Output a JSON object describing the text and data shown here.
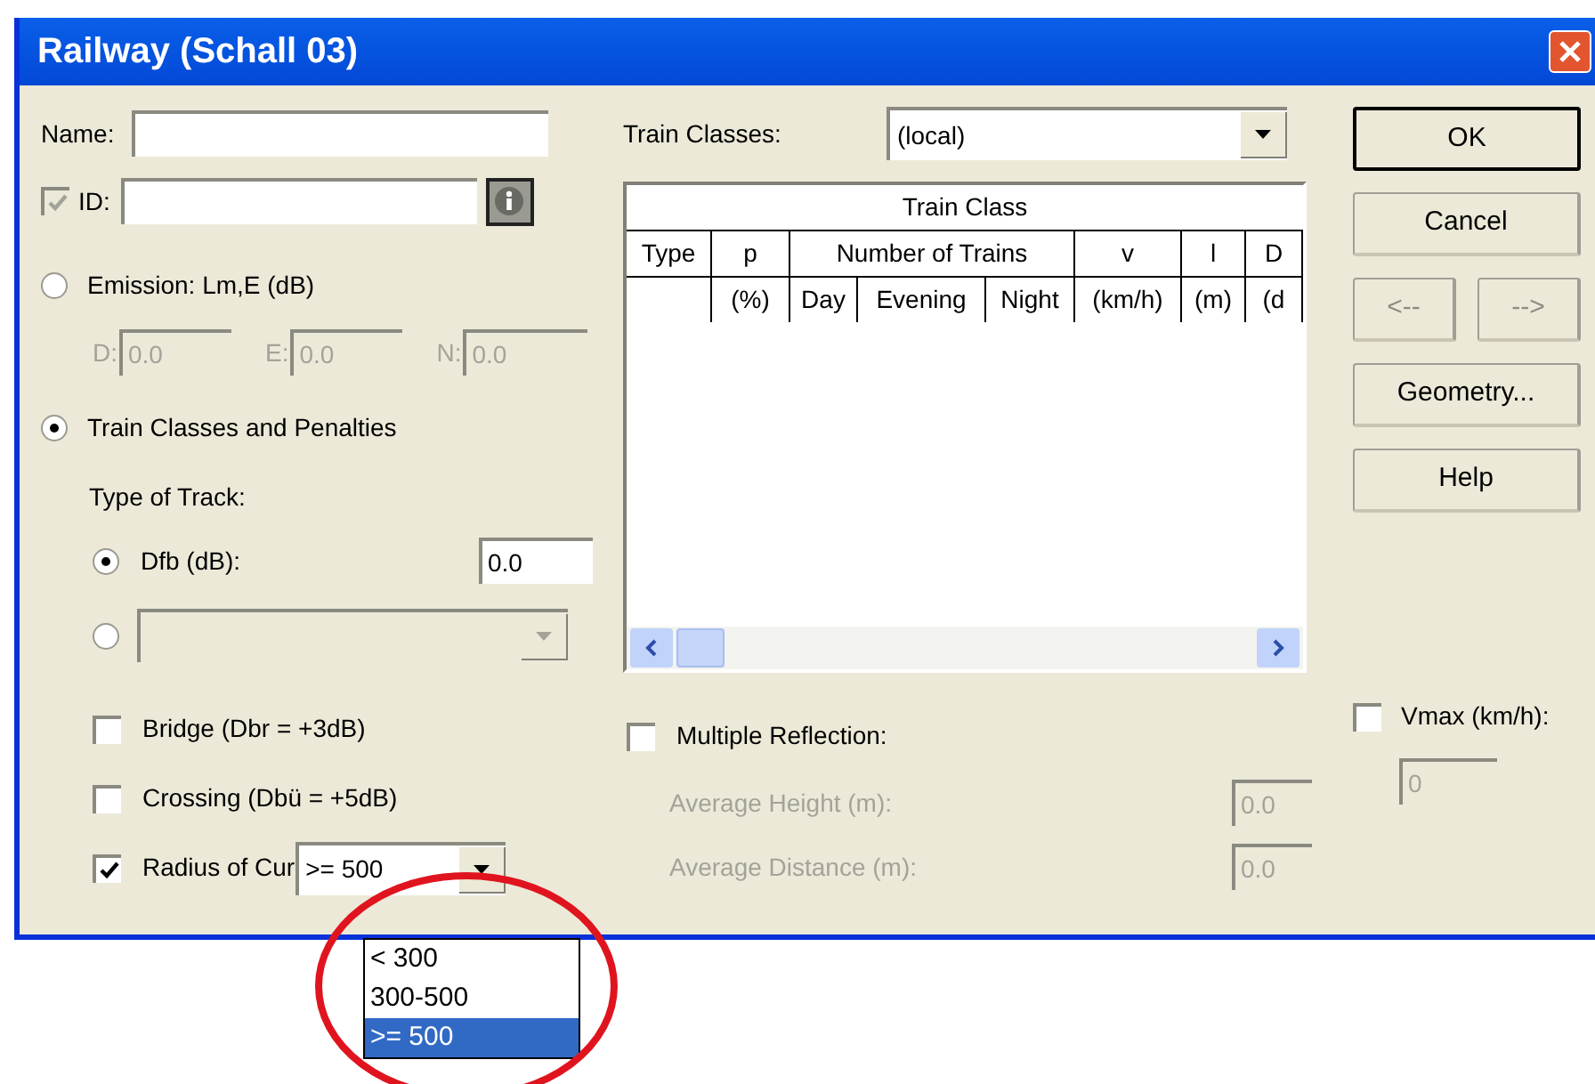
{
  "window": {
    "title": "Railway (Schall 03)"
  },
  "name_field": {
    "label": "Name:"
  },
  "id_field": {
    "label": "ID:",
    "checked": true,
    "disabled": true
  },
  "emission": {
    "label": "Emission: Lm,E (dB)",
    "selected": false,
    "fields": [
      {
        "label": "D:",
        "value": "0.0",
        "disabled": true
      },
      {
        "label": "E:",
        "value": "0.0",
        "disabled": true
      },
      {
        "label": "N:",
        "value": "0.0",
        "disabled": true
      }
    ]
  },
  "train_classes_option": {
    "label": "Train Classes and Penalties",
    "selected": true
  },
  "type_of_track": {
    "label": "Type of Track:",
    "options": [
      {
        "kind": "field",
        "label": "Dfb (dB):",
        "value": "0.0",
        "selected": true,
        "disabled": false
      },
      {
        "kind": "combo",
        "selected": false,
        "disabled": true
      }
    ]
  },
  "penalties": [
    {
      "label": "Bridge (Dbr = +3dB)",
      "checked": false
    },
    {
      "label": "Crossing (Dbü = +5dB)",
      "checked": false
    },
    {
      "label": "Radius of Cur",
      "checked": true,
      "value": ">= 500",
      "expanded": true,
      "options": [
        {
          "label": "< 300",
          "selected": false
        },
        {
          "label": "300-500",
          "selected": false
        },
        {
          "label": ">= 500",
          "selected": true
        }
      ]
    }
  ],
  "train_classes": {
    "label": "Train Classes:",
    "value": "(local)"
  },
  "table": {
    "group": "Train Class",
    "columns": [
      {
        "label": "Type"
      },
      {
        "label": "p",
        "unit": "(%)"
      },
      {
        "label": "Number of Trains",
        "sub": [
          "Day",
          "Evening",
          "Night"
        ]
      },
      {
        "label": "v",
        "unit": "(km/h)"
      },
      {
        "label": "l",
        "unit": "(m)"
      },
      {
        "label": "D",
        "unit": "(d"
      }
    ]
  },
  "reflection": {
    "label": "Multiple Reflection:",
    "checked": false,
    "fields": [
      {
        "label": "Average Height (m):",
        "value": "0.0",
        "disabled": true
      },
      {
        "label": "Average Distance (m):",
        "value": "0.0",
        "disabled": true
      }
    ]
  },
  "buttons": [
    {
      "label": "OK",
      "disabled": false,
      "default": true
    },
    {
      "label": "Cancel",
      "disabled": false,
      "default": false
    },
    {
      "label": "<--",
      "disabled": true,
      "default": false
    },
    {
      "label": "-->",
      "disabled": true,
      "default": false
    },
    {
      "label": "Geometry...",
      "disabled": false,
      "default": false
    },
    {
      "label": "Help",
      "disabled": false,
      "default": false
    }
  ],
  "vmax": {
    "label": "Vmax (km/h):",
    "checked": false,
    "value": "0",
    "disabled": true
  }
}
